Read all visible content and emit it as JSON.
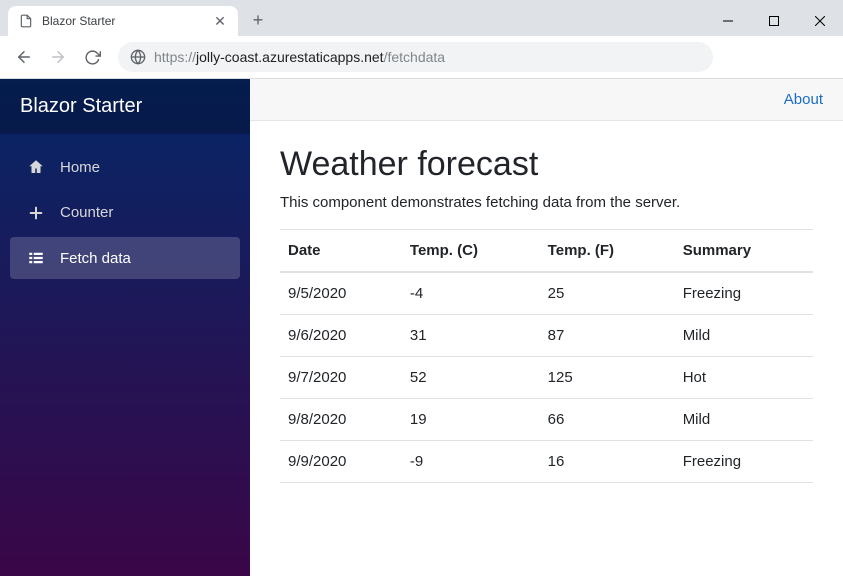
{
  "browser": {
    "tab_title": "Blazor Starter",
    "url_scheme": "https://",
    "url_host": "jolly-coast.azurestaticapps.net",
    "url_path": "/fetchdata"
  },
  "sidebar": {
    "brand": "Blazor Starter",
    "items": [
      {
        "label": "Home"
      },
      {
        "label": "Counter"
      },
      {
        "label": "Fetch data"
      }
    ]
  },
  "topbar": {
    "about": "About"
  },
  "page": {
    "title": "Weather forecast",
    "subtitle": "This component demonstrates fetching data from the server."
  },
  "table": {
    "headers": [
      "Date",
      "Temp. (C)",
      "Temp. (F)",
      "Summary"
    ],
    "rows": [
      {
        "date": "9/5/2020",
        "c": "-4",
        "f": "25",
        "summary": "Freezing"
      },
      {
        "date": "9/6/2020",
        "c": "31",
        "f": "87",
        "summary": "Mild"
      },
      {
        "date": "9/7/2020",
        "c": "52",
        "f": "125",
        "summary": "Hot"
      },
      {
        "date": "9/8/2020",
        "c": "19",
        "f": "66",
        "summary": "Mild"
      },
      {
        "date": "9/9/2020",
        "c": "-9",
        "f": "16",
        "summary": "Freezing"
      }
    ]
  }
}
